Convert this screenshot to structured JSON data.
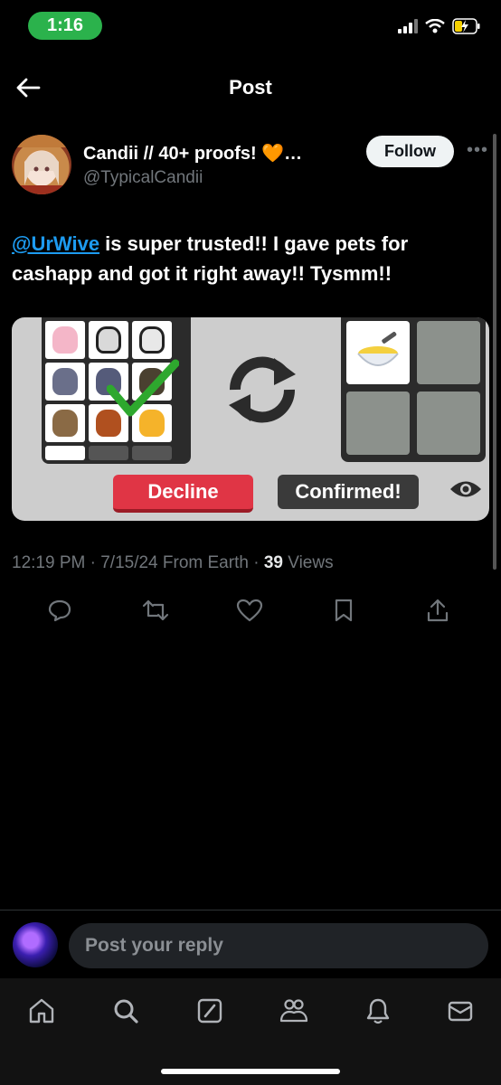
{
  "status_bar": {
    "time": "1:16"
  },
  "header": {
    "title": "Post"
  },
  "post": {
    "author_name": "Candii // 40+ proofs! 🧡…",
    "author_handle": "@TypicalCandii",
    "follow_label": "Follow",
    "more_label": "•••",
    "mention": "@UrWive",
    "text": " is super trusted!! I gave pets for cashapp and got it right away!! Tysmm!!",
    "media": {
      "decline_label": "Decline",
      "confirmed_label": "Confirmed!"
    },
    "meta": {
      "time": "12:19 PM",
      "date": "7/15/24",
      "location": "From Earth",
      "views_count": "39",
      "views_label": "Views"
    }
  },
  "reply": {
    "placeholder": "Post your reply"
  },
  "colors": {
    "accent": "#1d9bf0",
    "decline": "#e03545",
    "status_green": "#2bb24c"
  }
}
